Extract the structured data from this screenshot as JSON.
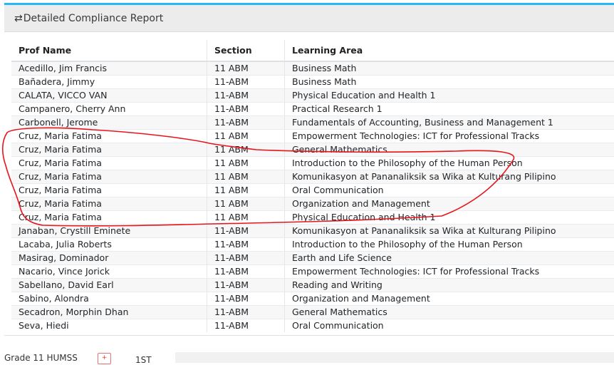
{
  "card": {
    "title": "Detailed Compliance Report",
    "icon": "swap-arrows-icon"
  },
  "table": {
    "headers": [
      "Prof Name",
      "Section",
      "Learning Area"
    ],
    "rows": [
      [
        "Acedillo, Jim Francis",
        "11 ABM",
        "Business Math"
      ],
      [
        "Bañadera, Jimmy",
        "11-ABM",
        "Business Math"
      ],
      [
        "CALATA, VICCO VAN",
        "11-ABM",
        "Physical Education and Health 1"
      ],
      [
        "Campanero, Cherry Ann",
        "11-ABM",
        "Practical Research 1"
      ],
      [
        "Carbonell, Jerome",
        "11-ABM",
        "Fundamentals of Accounting, Business and Management 1"
      ],
      [
        "Cruz, Maria Fatima",
        "11 ABM",
        "Empowerment Technologies: ICT for Professional Tracks"
      ],
      [
        "Cruz, Maria Fatima",
        "11 ABM",
        "General Mathematics"
      ],
      [
        "Cruz, Maria Fatima",
        "11 ABM",
        "Introduction to the Philosophy of the Human Person"
      ],
      [
        "Cruz, Maria Fatima",
        "11 ABM",
        "Komunikasyon at Pananaliksik sa Wika at Kulturang Pilipino"
      ],
      [
        "Cruz, Maria Fatima",
        "11 ABM",
        "Oral Communication"
      ],
      [
        "Cruz, Maria Fatima",
        "11 ABM",
        "Organization and Management"
      ],
      [
        "Cruz, Maria Fatima",
        "11 ABM",
        "Physical Education and Health 1"
      ],
      [
        "Janaban, Crystill Eminete",
        "11-ABM",
        "Komunikasyon at Pananaliksik sa Wika at Kulturang Pilipino"
      ],
      [
        "Lacaba, Julia Roberts",
        "11-ABM",
        "Introduction to the Philosophy of the Human Person"
      ],
      [
        "Masirag, Dominador",
        "11-ABM",
        "Earth and Life Science"
      ],
      [
        "Nacario, Vince Jorick",
        "11-ABM",
        "Empowerment Technologies: ICT for Professional Tracks"
      ],
      [
        "Sabellano, David Earl",
        "11-ABM",
        "Reading and Writing"
      ],
      [
        "Sabino, Alondra",
        "11-ABM",
        "Organization and Management"
      ],
      [
        "Secadron, Morphin Dhan",
        "11-ABM",
        "General Mathematics"
      ],
      [
        "Seva, Hiedi",
        "11-ABM",
        "Oral Communication"
      ]
    ]
  },
  "footer": {
    "grade_label": "Grade 11 HUMSS",
    "add_button_label": "+",
    "semester_label": "1ST"
  },
  "colors": {
    "header_accent": "#29b6f6",
    "annotation": "#e8141c"
  }
}
